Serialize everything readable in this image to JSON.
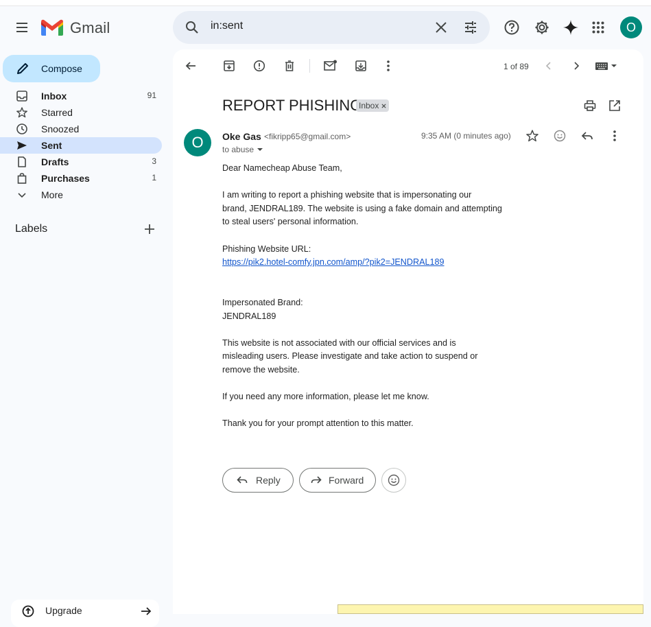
{
  "app": {
    "name": "Gmail"
  },
  "search": {
    "query": "in:sent"
  },
  "user": {
    "avatar_letter": "O"
  },
  "sidebar": {
    "compose_label": "Compose",
    "items": [
      {
        "label": "Inbox",
        "count": "91"
      },
      {
        "label": "Starred",
        "count": ""
      },
      {
        "label": "Snoozed",
        "count": ""
      },
      {
        "label": "Sent",
        "count": ""
      },
      {
        "label": "Drafts",
        "count": "3"
      },
      {
        "label": "Purchases",
        "count": "1"
      },
      {
        "label": "More",
        "count": ""
      }
    ],
    "labels_title": "Labels",
    "upgrade_label": "Upgrade"
  },
  "toolbar": {
    "count_text": "1 of 89"
  },
  "email": {
    "subject": "REPORT PHISHING",
    "label_chip": "Inbox",
    "sender_avatar": "O",
    "sender_name": "Oke Gas",
    "sender_email": "<fikripp65@gmail.com>",
    "to_line": "to abuse",
    "timestamp": "9:35 AM (0 minutes ago)",
    "body": {
      "greeting": "Dear Namecheap Abuse Team,",
      "p1_l1": "I am writing to report a phishing website that is impersonating our",
      "p1_l2": "brand, JENDRAL189. The website is using a fake domain and attempting",
      "p1_l3": "to steal users' personal information.",
      "url_label": "Phishing Website URL:",
      "url": "https://pik2.hotel-comfy.jpn.com/amp/?pik2=JENDRAL189",
      "brand_label": "Impersonated Brand:",
      "brand": "JENDRAL189",
      "p2_l1": "This website is not associated with our official services and is",
      "p2_l2": "misleading users. Please investigate and take action to suspend or",
      "p2_l3": "remove the website.",
      "p3": "If you need any more information, please let me know.",
      "p4": "Thank you for your prompt attention to this matter."
    },
    "reply_label": "Reply",
    "forward_label": "Forward"
  },
  "colors": {
    "accent": "#0b57d0",
    "compose_bg": "#c2e7ff",
    "active_nav": "#d3e3fd",
    "avatar": "#00897b"
  }
}
